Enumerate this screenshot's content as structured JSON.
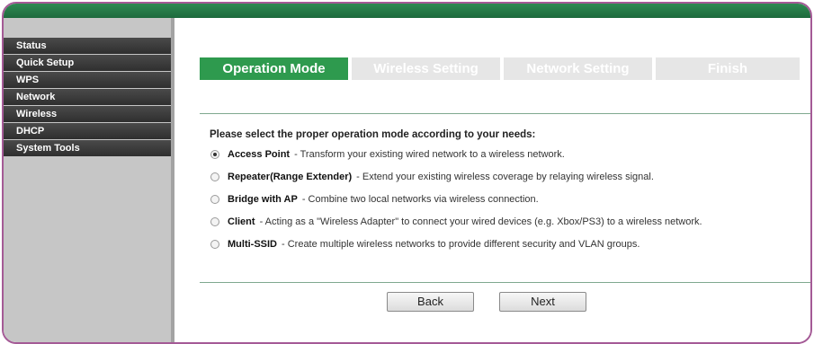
{
  "sidebar": {
    "items": [
      {
        "label": "Status"
      },
      {
        "label": "Quick Setup"
      },
      {
        "label": "WPS"
      },
      {
        "label": "Network"
      },
      {
        "label": "Wireless"
      },
      {
        "label": "DHCP"
      },
      {
        "label": "System Tools"
      }
    ]
  },
  "steps": [
    {
      "label": "Operation Mode"
    },
    {
      "label": "Wireless Setting"
    },
    {
      "label": "Network Setting"
    },
    {
      "label": "Finish"
    }
  ],
  "prompt": "Please select the proper operation mode according to your needs:",
  "options": [
    {
      "name": "Access Point",
      "desc": "- Transform your existing wired network to a wireless network.",
      "selected": true
    },
    {
      "name": "Repeater(Range Extender)",
      "desc": "- Extend your existing wireless coverage by relaying wireless signal.",
      "selected": false
    },
    {
      "name": "Bridge with AP",
      "desc": "- Combine two local networks via wireless connection.",
      "selected": false
    },
    {
      "name": "Client",
      "desc": "- Acting as a \"Wireless Adapter\" to connect your wired devices (e.g. Xbox/PS3) to a wireless network.",
      "selected": false
    },
    {
      "name": "Multi-SSID",
      "desc": "- Create multiple wireless networks to provide different security and VLAN groups.",
      "selected": false
    }
  ],
  "buttons": {
    "back": "Back",
    "next": "Next"
  },
  "colors": {
    "accent_green": "#2e9a4e",
    "frame_border": "#a45a96"
  }
}
